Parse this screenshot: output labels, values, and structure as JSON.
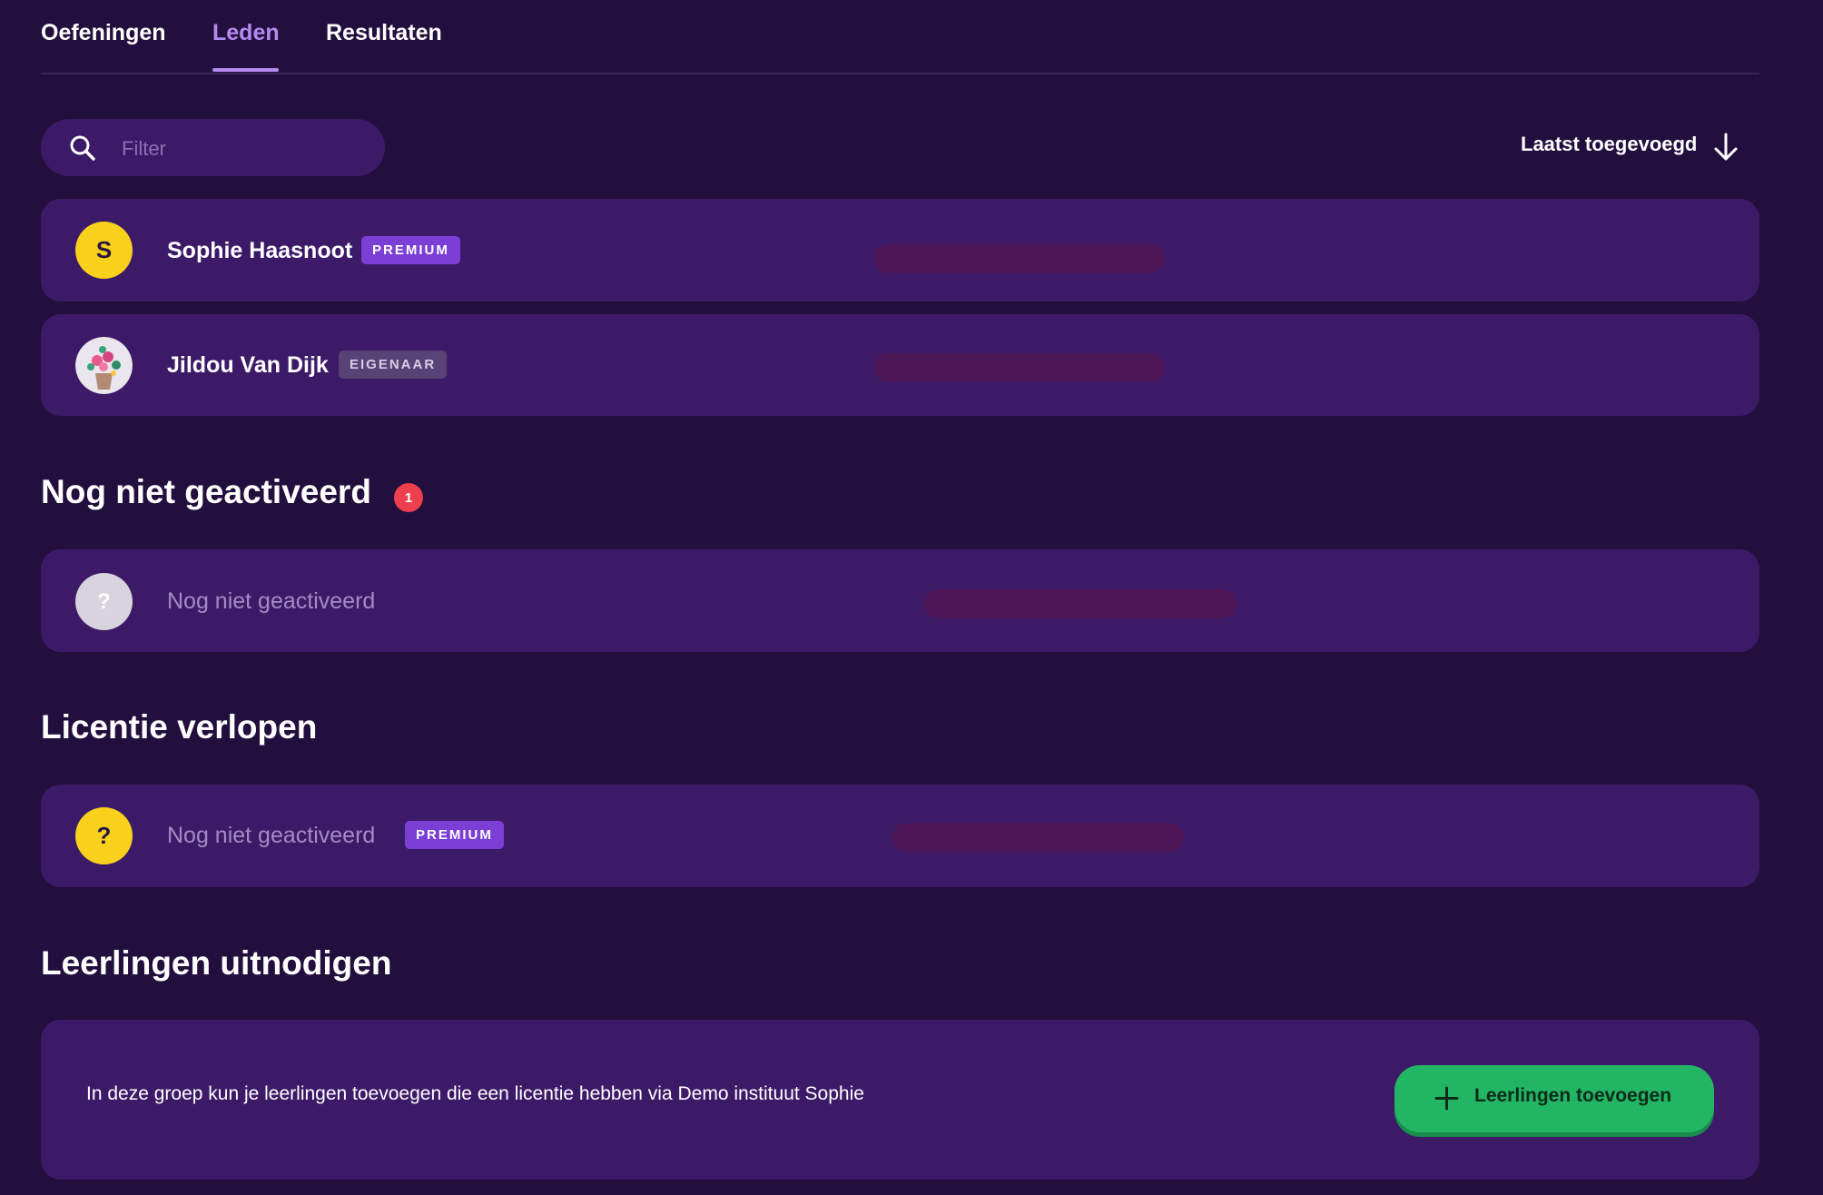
{
  "tabs": [
    {
      "label": "Oefeningen",
      "active": false
    },
    {
      "label": "Leden",
      "active": true
    },
    {
      "label": "Resultaten",
      "active": false
    }
  ],
  "search": {
    "placeholder": "Filter",
    "icon": "search-icon"
  },
  "sort": {
    "label": "Laatst toegevoegd",
    "icon": "arrow-down-icon"
  },
  "members": [
    {
      "avatar_letter": "S",
      "name": "Sophie Haasnoot",
      "badge": "PREMIUM"
    },
    {
      "avatar_icon": "flower-vase-photo",
      "name": "Jildou Van Dijk",
      "badge": "EIGENAAR"
    }
  ],
  "not_activated": {
    "title": "Nog niet geactiveerd",
    "count": "1",
    "items": [
      {
        "avatar_letter": "?",
        "name": "Nog niet geactiveerd"
      }
    ]
  },
  "expired": {
    "title": "Licentie verlopen",
    "items": [
      {
        "avatar_letter": "?",
        "name": "Nog niet geactiveerd",
        "badge": "PREMIUM"
      }
    ]
  },
  "invite": {
    "title": "Leerlingen uitnodigen",
    "text": "In deze groep kun je leerlingen toevoegen die een licentie hebben via Demo instituut Sophie",
    "button_label": "Leerlingen toevoegen",
    "button_icon": "plus-icon"
  },
  "colors": {
    "background": "#230f3e",
    "card": "#3d1a68",
    "accent": "#b58af0",
    "premium": "#7b3fd6",
    "success": "#22b563",
    "alert": "#ee3f4e",
    "avatar_yellow": "#f8d11c"
  }
}
